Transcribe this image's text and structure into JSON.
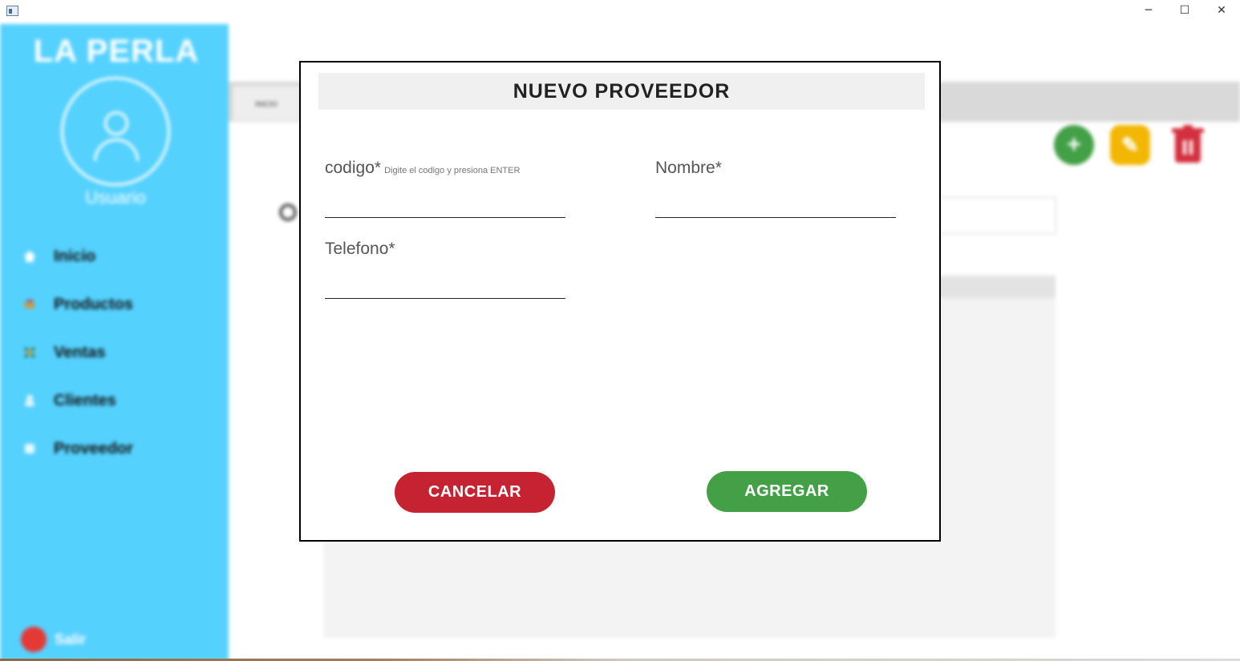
{
  "window": {
    "minimize_glyph": "─",
    "maximize_glyph": "☐",
    "close_glyph": "✕"
  },
  "sidebar": {
    "brand": "LA PERLA",
    "user_label": "Usuario",
    "items": [
      {
        "label": "Inicio",
        "icon": "home-icon"
      },
      {
        "label": "Productos",
        "icon": "products-icon"
      },
      {
        "label": "Ventas",
        "icon": "sales-icon"
      },
      {
        "label": "Clientes",
        "icon": "clients-icon"
      },
      {
        "label": "Proveedor",
        "icon": "supplier-icon"
      }
    ],
    "logout_label": "Salir"
  },
  "main": {
    "tab_label": "INICIO",
    "actions": {
      "add_glyph": "+",
      "edit_glyph": "✎",
      "delete_glyph": "🗑"
    }
  },
  "dialog": {
    "title": "NUEVO PROVEEDOR",
    "fields": {
      "codigo": {
        "label": "codigo*",
        "hint": "Digite el codigo y presiona ENTER",
        "value": ""
      },
      "nombre": {
        "label": "Nombre*",
        "value": ""
      },
      "telefono": {
        "label": "Telefono*",
        "value": ""
      }
    },
    "buttons": {
      "cancel": "CANCELAR",
      "add": "AGREGAR"
    }
  },
  "colors": {
    "sidebar": "#55d1fe",
    "cancel": "#c62332",
    "add": "#43a047",
    "action_add": "#43a047",
    "action_edit": "#f2b705",
    "action_delete": "#d32f3f"
  }
}
